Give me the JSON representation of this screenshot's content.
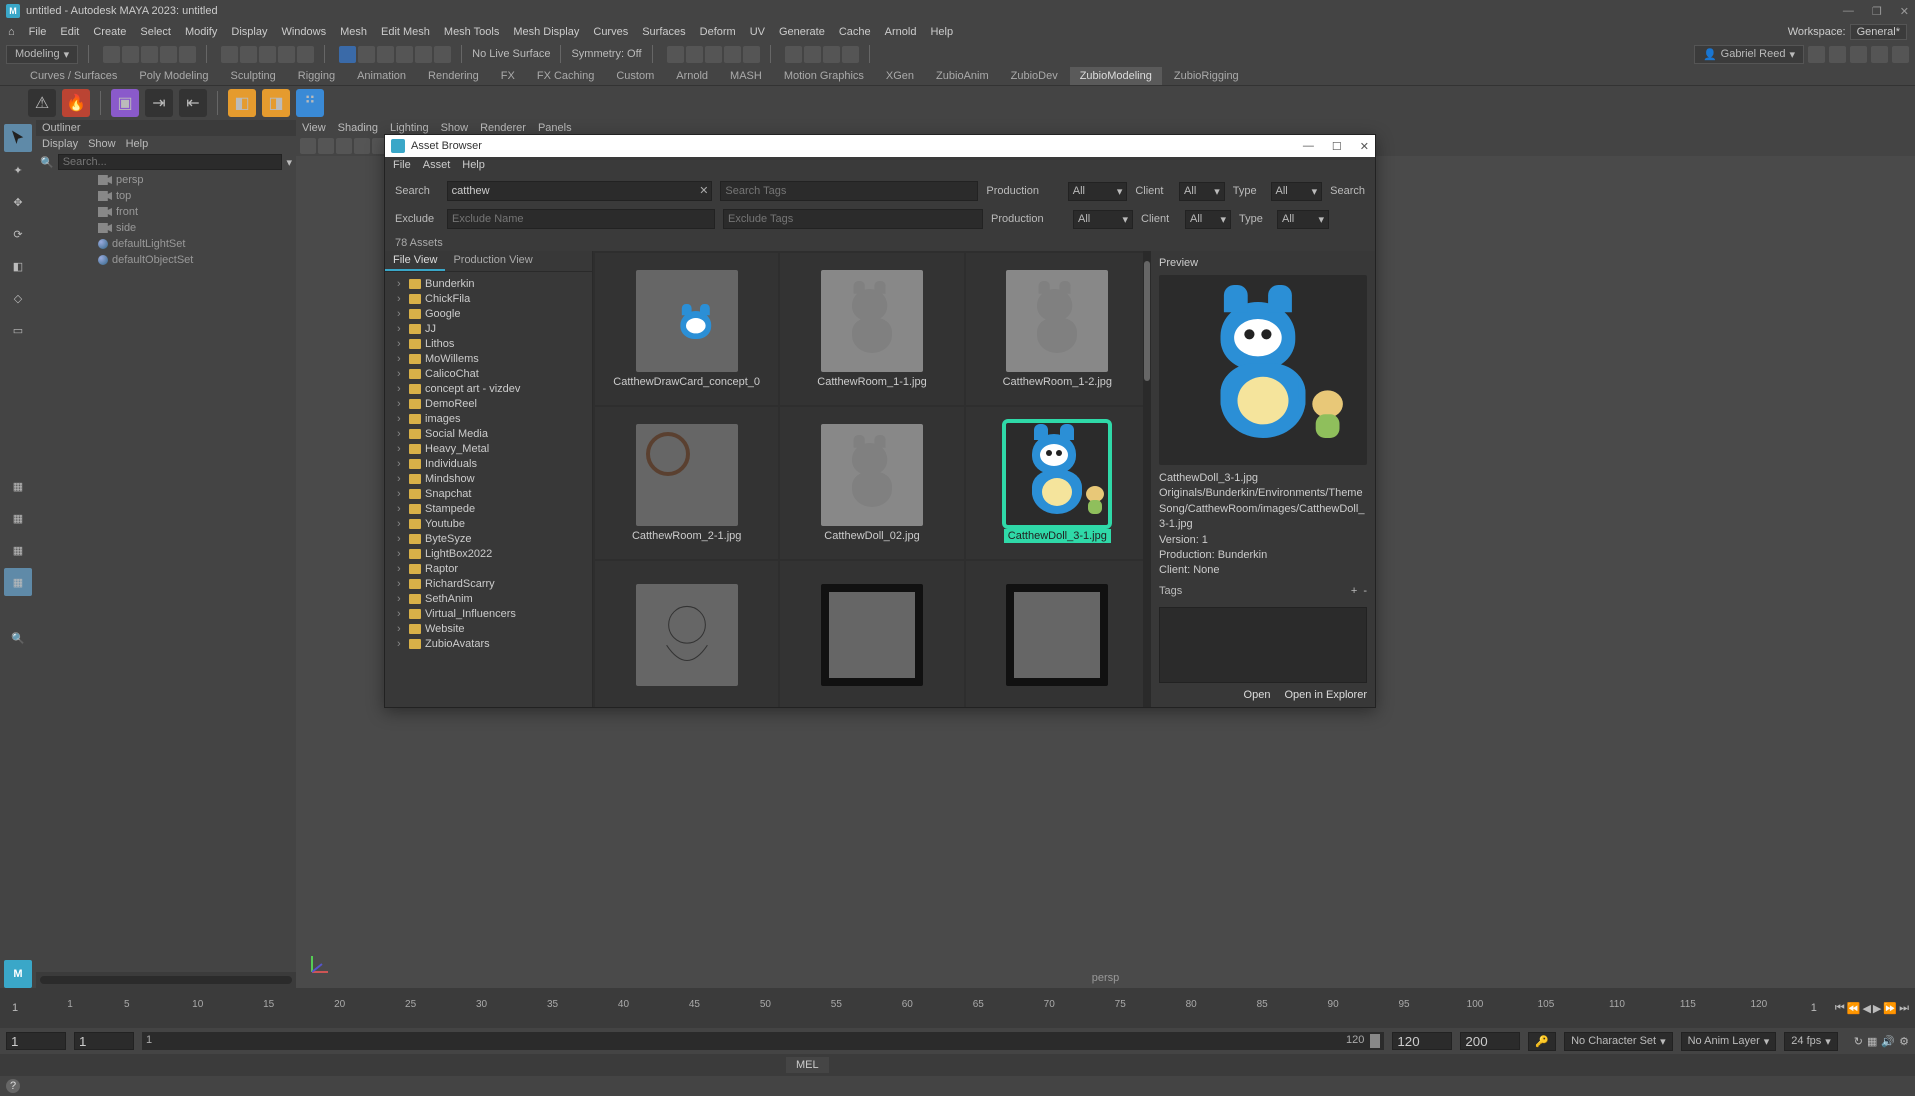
{
  "titlebar": {
    "text": "untitled - Autodesk MAYA 2023: untitled"
  },
  "menubar": {
    "items": [
      "File",
      "Edit",
      "Create",
      "Select",
      "Modify",
      "Display",
      "Windows",
      "Mesh",
      "Edit Mesh",
      "Mesh Tools",
      "Mesh Display",
      "Curves",
      "Surfaces",
      "Deform",
      "UV",
      "Generate",
      "Cache",
      "Arnold",
      "Help"
    ],
    "workspace_label": "Workspace:",
    "workspace_value": "General*"
  },
  "shelfbar": {
    "mode": "Modeling",
    "symmetry": "Symmetry: Off",
    "livesurface": "No Live Surface",
    "user": "Gabriel Reed"
  },
  "tabs": [
    "Curves / Surfaces",
    "Poly Modeling",
    "Sculpting",
    "Rigging",
    "Animation",
    "Rendering",
    "FX",
    "FX Caching",
    "Custom",
    "Arnold",
    "MASH",
    "Motion Graphics",
    "XGen",
    "ZubioAnim",
    "ZubioDev",
    "ZubioModeling",
    "ZubioRigging"
  ],
  "tabs_active": "ZubioModeling",
  "outliner": {
    "title": "Outliner",
    "menu": [
      "Display",
      "Show",
      "Help"
    ],
    "search_placeholder": "Search...",
    "items": [
      {
        "icon": "cam",
        "label": "persp"
      },
      {
        "icon": "cam",
        "label": "top"
      },
      {
        "icon": "cam",
        "label": "front"
      },
      {
        "icon": "cam",
        "label": "side"
      },
      {
        "icon": "ball",
        "label": "defaultLightSet"
      },
      {
        "icon": "ball",
        "label": "defaultObjectSet"
      }
    ]
  },
  "viewport": {
    "menu": [
      "View",
      "Shading",
      "Lighting",
      "Show",
      "Renderer",
      "Panels"
    ],
    "caption": "persp"
  },
  "assetwin": {
    "title": "Asset Browser",
    "menu": [
      "File",
      "Asset",
      "Help"
    ],
    "search_label": "Search",
    "search_value": "catthew",
    "search_tags_placeholder": "Search Tags",
    "exclude_label": "Exclude",
    "exclude_name_placeholder": "Exclude Name",
    "exclude_tags_placeholder": "Exclude Tags",
    "production_label": "Production",
    "client_label": "Client",
    "type_label": "Type",
    "all": "All",
    "search_btn": "Search",
    "count": "78 Assets",
    "tree_tabs": [
      "File View",
      "Production View"
    ],
    "tree_active": "File View",
    "folders": [
      "Bunderkin",
      "ChickFila",
      "Google",
      "JJ",
      "Lithos",
      "MoWillems",
      "CalicoChat",
      "concept art - vizdev",
      "DemoReel",
      "images",
      "Social Media",
      "Heavy_Metal",
      "Individuals",
      "Mindshow",
      "Snapchat",
      "Stampede",
      "Youtube",
      "ByteSyze",
      "LightBox2022",
      "Raptor",
      "RichardScarry",
      "SethAnim",
      "Virtual_Influencers",
      "Website",
      "ZubioAvatars"
    ],
    "thumbs": [
      {
        "label": "CatthewDrawCard_concept_0",
        "kind": "draw"
      },
      {
        "label": "CatthewRoom_1-1.jpg",
        "kind": "gray"
      },
      {
        "label": "CatthewRoom_1-2.jpg",
        "kind": "gray"
      },
      {
        "label": "CatthewRoom_2-1.jpg",
        "kind": "room"
      },
      {
        "label": "CatthewDoll_02.jpg",
        "kind": "gray"
      },
      {
        "label": "CatthewDoll_3-1.jpg",
        "kind": "char",
        "selected": true
      },
      {
        "label": "",
        "kind": "line"
      },
      {
        "label": "",
        "kind": "scene"
      },
      {
        "label": "",
        "kind": "scene"
      }
    ],
    "preview": {
      "title": "Preview",
      "name": "CatthewDoll_3-1.jpg",
      "path": "Originals/Bunderkin/Environments/ThemeSong/CatthewRoom/images/CatthewDoll_3-1.jpg",
      "version": "Version: 1",
      "production": "Production: Bunderkin",
      "client": "Client: None",
      "tags_label": "Tags",
      "plus": "+",
      "minus": "-",
      "open": "Open",
      "explorer": "Open in Explorer"
    }
  },
  "timeline": {
    "marks": [
      1,
      5,
      10,
      15,
      20,
      25,
      30,
      35,
      40,
      45,
      50,
      55,
      60,
      65,
      70,
      75,
      80,
      85,
      90,
      95,
      100,
      105,
      110,
      115,
      120
    ],
    "start": "1",
    "end": "1"
  },
  "status": {
    "f1": "1",
    "f2": "1",
    "f3": "1",
    "sliderEnd": "120",
    "g1": "120",
    "g2": "200",
    "charset": "No Character Set",
    "animlayer": "No Anim Layer",
    "fps": "24 fps"
  },
  "mel": "MEL"
}
